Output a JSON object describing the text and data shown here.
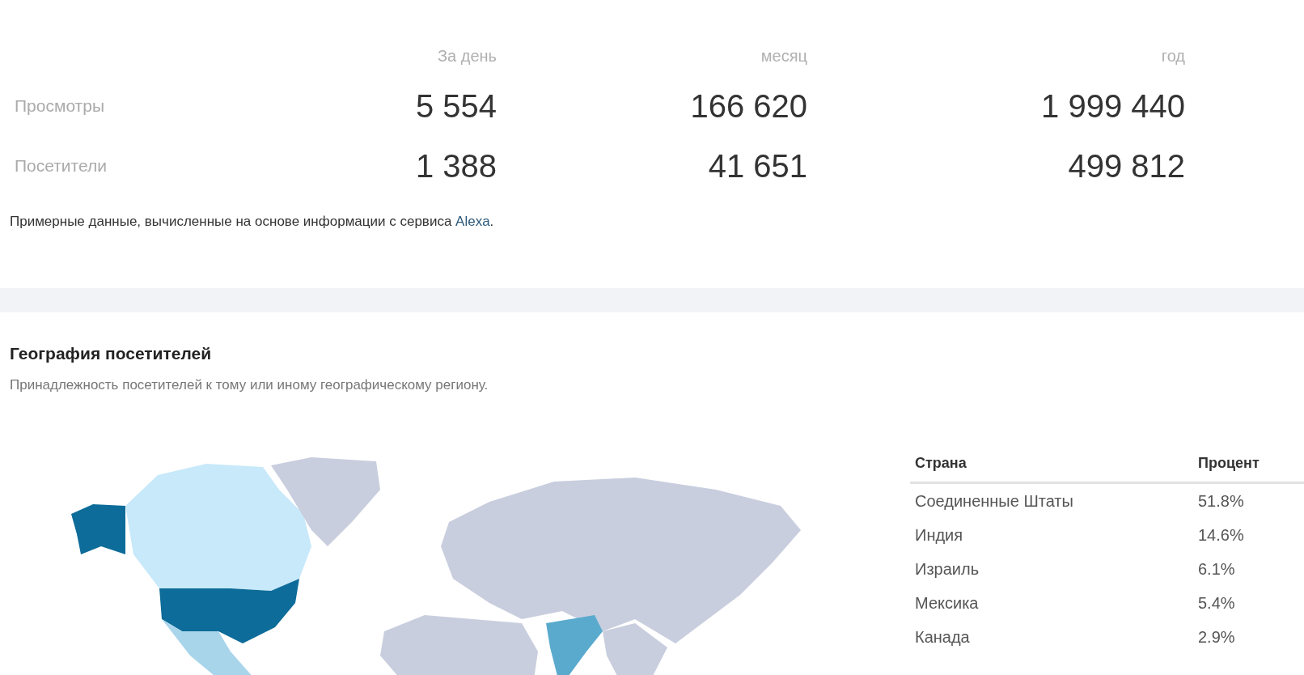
{
  "stats": {
    "columns": [
      "За день",
      "месяц",
      "год"
    ],
    "rows": [
      {
        "label": "Просмотры",
        "values": [
          "5 554",
          "166 620",
          "1 999 440"
        ]
      },
      {
        "label": "Посетители",
        "values": [
          "1 388",
          "41 651",
          "499 812"
        ]
      }
    ]
  },
  "note": {
    "text": "Примерные данные, вычисленные на основе информации с сервиса ",
    "link": "Alexa",
    "tail": "."
  },
  "geo": {
    "title": "География посетителей",
    "subtitle": "Принадлежность посетителей к тому или иному географическому региону.",
    "table": {
      "columns": [
        "Страна",
        "Процент"
      ],
      "rows": [
        [
          "Соединенные Штаты",
          "51.8%"
        ],
        [
          "Индия",
          "14.6%"
        ],
        [
          "Израиль",
          "6.1%"
        ],
        [
          "Мексика",
          "5.4%"
        ],
        [
          "Канада",
          "2.9%"
        ]
      ]
    }
  }
}
